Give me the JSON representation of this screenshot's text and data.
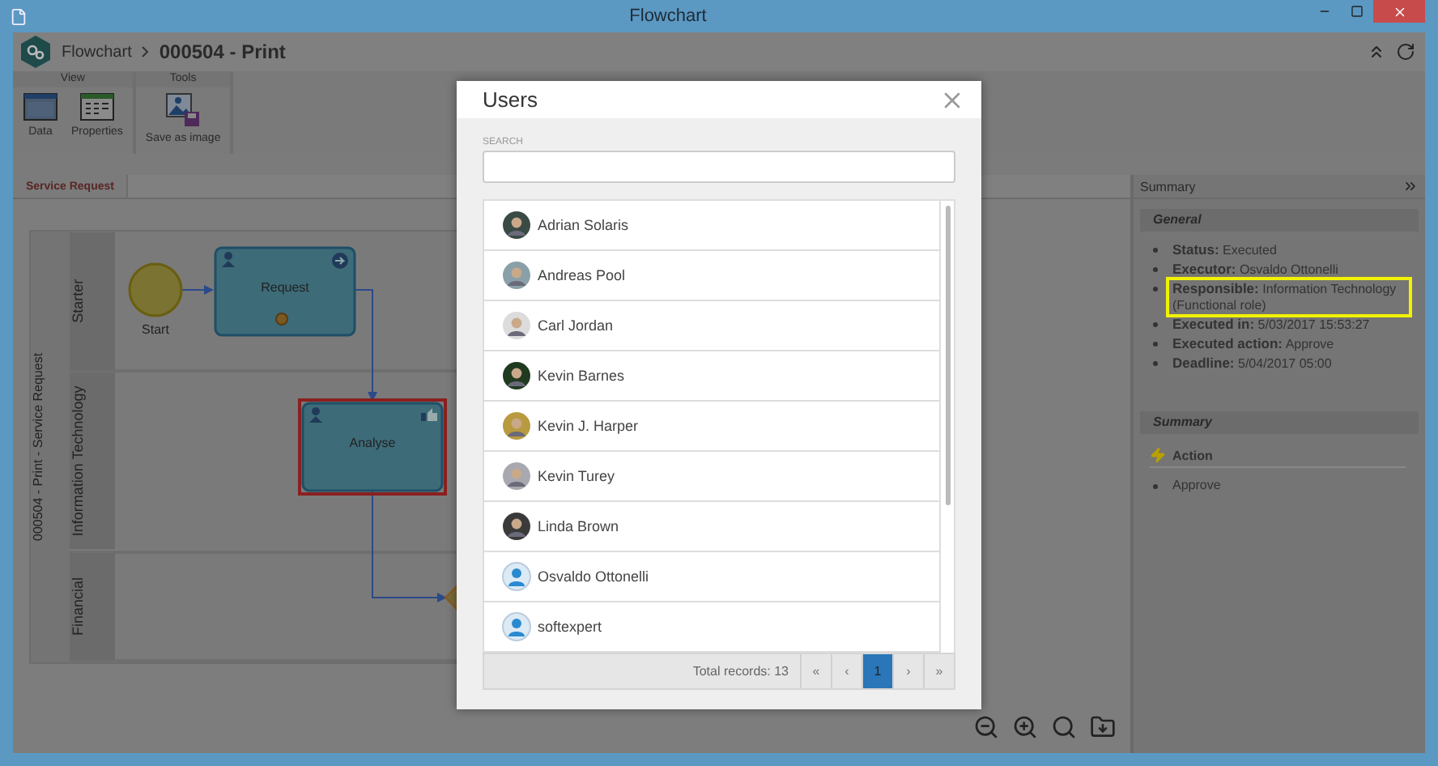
{
  "window": {
    "title": "Flowchart"
  },
  "breadcrumb": [
    "Flowchart",
    "000504 - Print"
  ],
  "ribbon": [
    {
      "label": "View",
      "buttons": [
        {
          "label": "Data",
          "kind": "data"
        },
        {
          "label": "Properties",
          "kind": "properties"
        }
      ]
    },
    {
      "label": "Tools",
      "buttons": [
        {
          "label": "Save as image",
          "kind": "image"
        }
      ]
    }
  ],
  "tabs": [
    {
      "label": "Service Request",
      "selected": true
    }
  ],
  "diagram": {
    "pool": "000504 - Print - Service Request",
    "lanes": [
      "Starter",
      "Information Technology",
      "Financial"
    ],
    "nodes": [
      {
        "kind": "start",
        "label": "Start",
        "selected": false
      },
      {
        "kind": "task",
        "label": "Request",
        "selected": false
      },
      {
        "kind": "task",
        "label": "Analyse",
        "selected": true
      }
    ]
  },
  "summary": {
    "title": "Summary",
    "general": {
      "heading": "General",
      "fields": [
        {
          "label": "Status:",
          "value": "Executed",
          "highlighted": false
        },
        {
          "label": "Executor:",
          "value": "Osvaldo Ottonelli",
          "highlighted": false
        },
        {
          "label": "Responsible:",
          "value": "Information Technology (Functional role)",
          "highlighted": true
        },
        {
          "label": "Executed in:",
          "value": "5/03/2017 15:53:27",
          "highlighted": false
        },
        {
          "label": "Executed action:",
          "value": "Approve",
          "highlighted": false
        },
        {
          "label": "Deadline:",
          "value": "5/04/2017 05:00",
          "highlighted": false
        }
      ]
    },
    "section": {
      "heading": "Summary",
      "action": "Action",
      "items": [
        "Approve"
      ]
    }
  },
  "dialog": {
    "title": "Users",
    "search": {
      "label": "SEARCH"
    },
    "users": [
      {
        "name": "Adrian Solaris",
        "kind": "photo"
      },
      {
        "name": "Andreas Pool",
        "kind": "photo"
      },
      {
        "name": "Carl Jordan",
        "kind": "photo"
      },
      {
        "name": "Kevin Barnes",
        "kind": "photo"
      },
      {
        "name": "Kevin J. Harper",
        "kind": "photo"
      },
      {
        "name": "Kevin Turey",
        "kind": "photo"
      },
      {
        "name": "Linda Brown",
        "kind": "photo"
      },
      {
        "name": "Osvaldo Ottonelli",
        "kind": "generic"
      },
      {
        "name": "softexpert",
        "kind": "generic"
      }
    ],
    "total": "Total records: 13",
    "pager": [
      {
        "label": "«",
        "selected": false
      },
      {
        "label": "‹",
        "selected": false
      },
      {
        "label": "1",
        "selected": true
      },
      {
        "label": "›",
        "selected": false
      },
      {
        "label": "»",
        "selected": false
      }
    ]
  }
}
